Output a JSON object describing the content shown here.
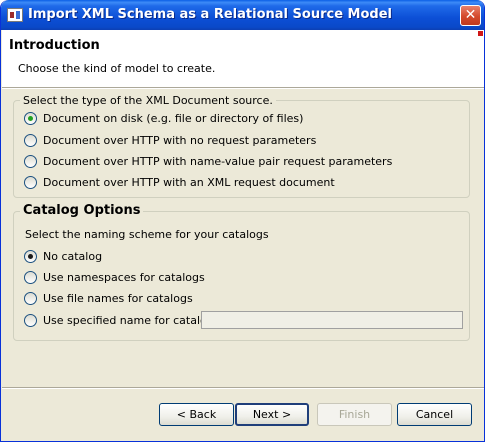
{
  "window": {
    "title": "Import XML Schema as a Relational Source Model",
    "close_glyph": "✕",
    "icon": "app-icon"
  },
  "header": {
    "title": "Introduction",
    "description": "Choose the kind of model to create."
  },
  "source_group": {
    "legend": "Select the type of the XML Document source.",
    "options": [
      {
        "label": "Document on disk (e.g. file or directory of files)",
        "checked": true
      },
      {
        "label": "Document over HTTP with no request parameters",
        "checked": false
      },
      {
        "label": "Document over HTTP with name-value pair request parameters",
        "checked": false
      },
      {
        "label": "Document over HTTP with an XML request document",
        "checked": false
      }
    ]
  },
  "catalog_group": {
    "legend": "Catalog Options",
    "description": "Select the naming scheme for your catalogs",
    "options": [
      {
        "label": "No catalog",
        "checked": true
      },
      {
        "label": "Use namespaces for catalogs",
        "checked": false
      },
      {
        "label": "Use file names for catalogs",
        "checked": false
      },
      {
        "label": "Use specified name for catalog:",
        "checked": false
      }
    ],
    "catalog_name_value": ""
  },
  "buttons": {
    "back": "< Back",
    "next": "Next >",
    "finish": "Finish",
    "cancel": "Cancel"
  },
  "colors": {
    "titlebar": "#0a49c9",
    "dialog_bg": "#ece9d8",
    "radio_selected": "#21a121",
    "close_button": "#d4492c"
  }
}
